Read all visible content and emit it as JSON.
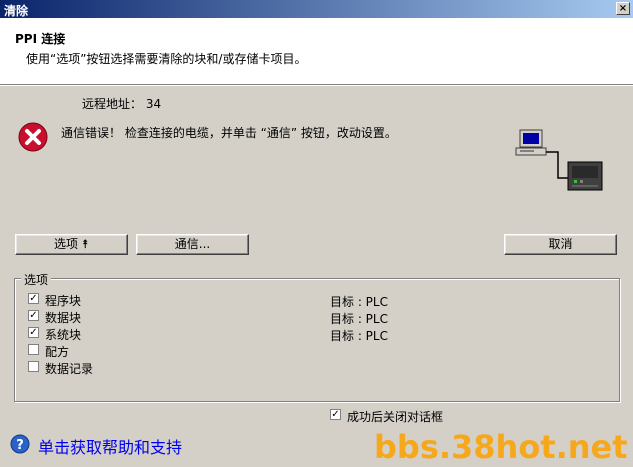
{
  "window": {
    "title": "清除",
    "close_glyph": "×"
  },
  "header": {
    "title": "PPI 连接",
    "subtitle": "使用“选项”按钮选择需要清除的块和/或存储卡项目。"
  },
  "remote_address": "远程地址： 34",
  "error": {
    "icon": "error-icon",
    "message": "通信错误！ 检查连接的电缆，并单击 “通信” 按钮，改动设置。"
  },
  "buttons": {
    "options": "选项 ⯭",
    "comm": "通信...",
    "cancel": "取消"
  },
  "options_group": {
    "label": "选项",
    "items": [
      {
        "label": "程序块",
        "checked": true,
        "target": "目标 : PLC"
      },
      {
        "label": "数据块",
        "checked": true,
        "target": "目标 : PLC"
      },
      {
        "label": "系统块",
        "checked": true,
        "target": "目标 : PLC"
      },
      {
        "label": "配方",
        "checked": false,
        "target": ""
      },
      {
        "label": "数据记录",
        "checked": false,
        "target": ""
      }
    ]
  },
  "close_on_success": {
    "label": "成功后关闭对话框",
    "checked": true
  },
  "help": {
    "label": "单击获取帮助和支持",
    "icon": "help-icon"
  },
  "watermark": "bbs.38hot.net",
  "colors": {
    "title_start": "#0a246a",
    "title_end": "#a6caf0",
    "error_red": "#c8102e",
    "link": "#0000ee",
    "watermark": "#f6a81c"
  }
}
